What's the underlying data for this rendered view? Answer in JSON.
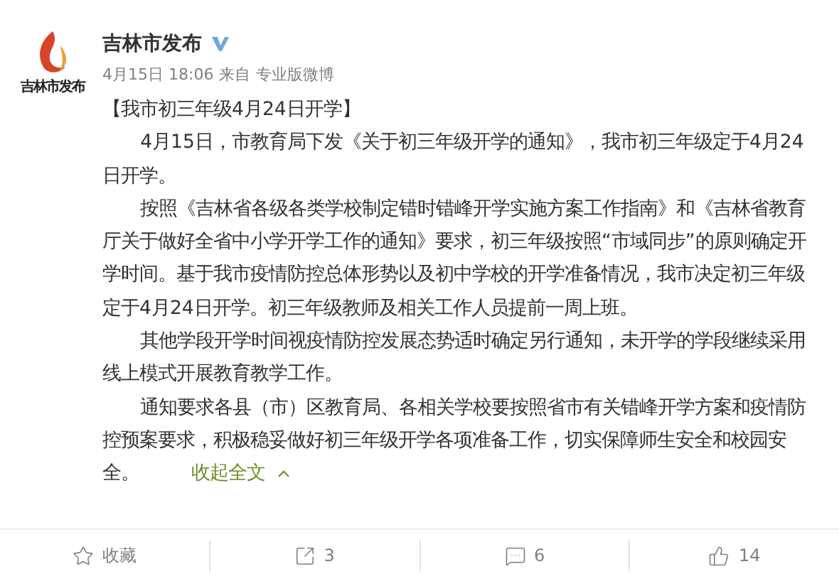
{
  "account": {
    "logo_text": "吉林市发布",
    "name": "吉林市发布",
    "verified": true,
    "date": "4月15日 18:06",
    "source_prefix": "来自",
    "source": "专业版微博"
  },
  "post": {
    "headline": "【我市初三年级4月24日开学】",
    "paragraphs": [
      "4月15日，市教育局下发《关于初三年级开学的通知》，我市初三年级定于4月24日开学。",
      "按照《吉林省各级各类学校制定错时错峰开学实施方案工作指南》和《吉林省教育厅关于做好全省中小学开学工作的通知》要求，初三年级按照“市域同步”的原则确定开学时间。基于我市疫情防控总体形势以及初中学校的开学准备情况，我市决定初三年级定于4月24日开学。初三年级教师及相关工作人员提前一周上班。",
      "其他学段开学时间视疫情防控发展态势适时确定另行通知，未开学的学段继续采用线上模式开展教育教学工作。",
      "通知要求各县（市）区教育局、各相关学校要按照省市有关错峰开学方案和疫情防控预案要求，积极稳妥做好初三年级开学各项准备工作，切实保障师生安全和校园安全。"
    ],
    "collapse_link": "收起全文"
  },
  "actions": [
    {
      "kind": "favorite",
      "label": "收藏"
    },
    {
      "kind": "repost",
      "label": "3"
    },
    {
      "kind": "comment",
      "label": "6"
    },
    {
      "kind": "like",
      "label": "14"
    }
  ]
}
